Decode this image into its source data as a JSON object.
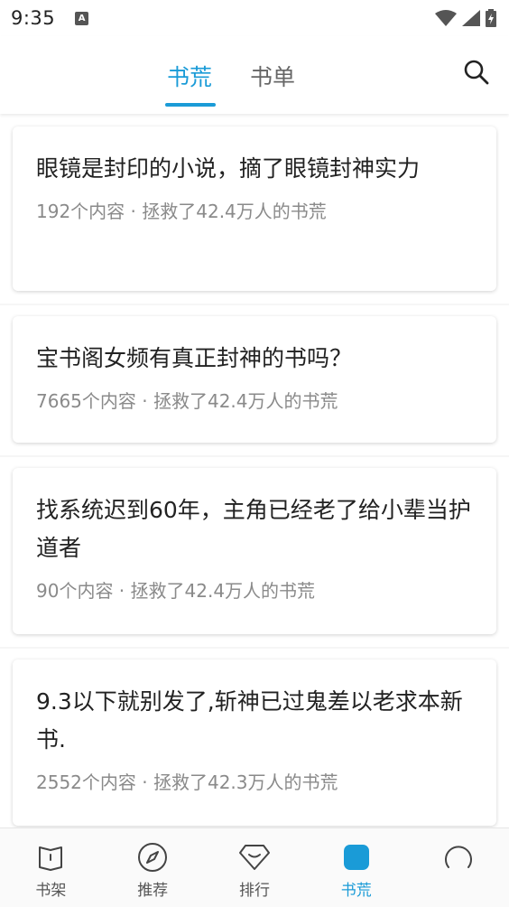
{
  "status_bar": {
    "time": "9:35",
    "notification_icon": "A"
  },
  "header": {
    "tabs": [
      {
        "label": "书荒",
        "active": true
      },
      {
        "label": "书单",
        "active": false
      }
    ],
    "search_icon": "search-icon",
    "accent_color": "#1a9bd7"
  },
  "cards": [
    {
      "title": "眼镜是封印的小说，摘了眼镜封神实力",
      "meta": "192个内容 · 拯救了42.4万人的书荒"
    },
    {
      "title": "宝书阁女频有真正封神的书吗？",
      "meta": "7665个内容 · 拯救了42.4万人的书荒"
    },
    {
      "title": "找系统迟到60年，主角已经老了给小辈当护道者",
      "meta": "90个内容 · 拯救了42.4万人的书荒"
    },
    {
      "title": "9.3以下就别发了,斩神已过鬼差以老求本新书.",
      "meta": "2552个内容 · 拯救了42.3万人的书荒"
    }
  ],
  "bottom_nav": [
    {
      "label": "书架",
      "icon": "bookshelf-icon",
      "active": false
    },
    {
      "label": "推荐",
      "icon": "compass-icon",
      "active": false
    },
    {
      "label": "排行",
      "icon": "ranking-icon",
      "active": false
    },
    {
      "label": "书荒",
      "icon": "book-shortage-icon",
      "active": true
    },
    {
      "label": "",
      "icon": "profile-icon",
      "active": false
    }
  ]
}
